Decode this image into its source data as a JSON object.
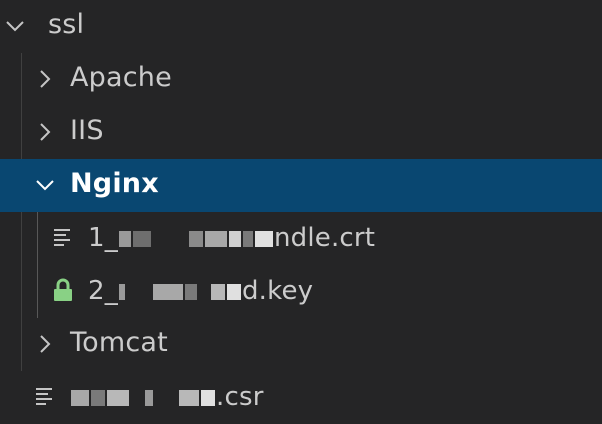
{
  "explorer": {
    "root": {
      "label": "ssl",
      "expanded": true
    },
    "items": [
      {
        "label": "Apache",
        "kind": "folder",
        "expanded": false
      },
      {
        "label": "IIS",
        "kind": "folder",
        "expanded": false
      },
      {
        "label": "Nginx",
        "kind": "folder",
        "expanded": true,
        "selected": true,
        "children": [
          {
            "prefix": "1_",
            "suffix": "ndle.crt",
            "icon": "lines-file-icon"
          },
          {
            "prefix": "2_",
            "suffix": "d.key",
            "icon": "lock-icon",
            "icon_color": "#89d185"
          }
        ]
      },
      {
        "label": "Tomcat",
        "kind": "folder",
        "expanded": false
      }
    ],
    "root_file": {
      "prefix": "",
      "suffix": ".csr",
      "icon": "lines-file-icon"
    }
  },
  "colors": {
    "background": "#252526",
    "selection": "#094771",
    "text": "#cccccc",
    "selected_text": "#ffffff",
    "lock": "#89d185"
  }
}
